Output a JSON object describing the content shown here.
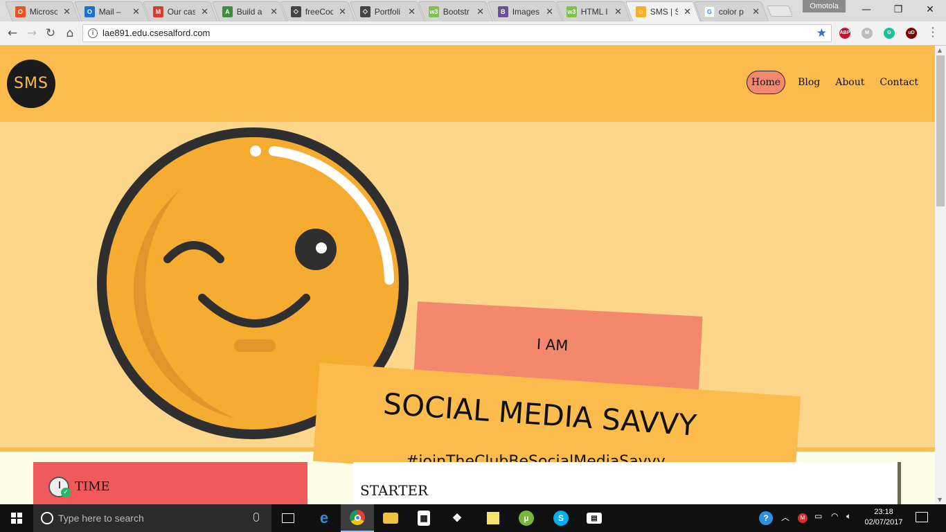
{
  "browser": {
    "tabs": [
      {
        "title": "Microsof",
        "icon": "office-icon",
        "color": "#e8541f",
        "glyph": "O"
      },
      {
        "title": "Mail – ",
        "icon": "outlook-icon",
        "color": "#1d6fcc",
        "glyph": "O"
      },
      {
        "title": "Our cas",
        "icon": "gmail-icon",
        "color": "#d93b2f",
        "glyph": "M"
      },
      {
        "title": "Build a",
        "icon": "build-icon",
        "color": "#3a8f3a",
        "glyph": "A"
      },
      {
        "title": "freeCod",
        "icon": "codepen-icon",
        "color": "#444444",
        "glyph": "◇"
      },
      {
        "title": "Portfoli",
        "icon": "codepen-icon",
        "color": "#444444",
        "glyph": "◇"
      },
      {
        "title": "Bootstr",
        "icon": "w3-icon",
        "color": "#7cc24c",
        "glyph": "w3"
      },
      {
        "title": "Images",
        "icon": "bootstrap-icon",
        "color": "#6b4f97",
        "glyph": "B"
      },
      {
        "title": "HTML I",
        "icon": "w3-icon",
        "color": "#7cc24c",
        "glyph": "w3"
      },
      {
        "title": "SMS | S",
        "icon": "smiley-icon",
        "color": "#f5b02e",
        "glyph": "☺"
      },
      {
        "title": "color p",
        "icon": "google-icon",
        "color": "#ffffff",
        "glyph": "G"
      }
    ],
    "profile_name": "Omotola",
    "url": "lae891.edu.csesalford.com",
    "extensions": [
      {
        "name": "adblock-icon",
        "glyph": "ABP",
        "color": "#c8102e"
      },
      {
        "name": "mail-ext-icon",
        "glyph": "M",
        "color": "#bdbdbd"
      },
      {
        "name": "grammarly-icon",
        "glyph": "G",
        "color": "#15c39a"
      },
      {
        "name": "ublock-icon",
        "glyph": "uD",
        "color": "#800000"
      }
    ]
  },
  "site": {
    "logo": "SMS",
    "nav": [
      "Home",
      "Blog",
      "About",
      "Contact"
    ],
    "hero": {
      "iam": "I AM",
      "title": "SOCIAL MEDIA SAVVY",
      "hashtag": "#joinTheClubBeSocialMediaSavvy"
    },
    "cards": {
      "time_label": "TIME",
      "starter_label": "STARTER"
    }
  },
  "taskbar": {
    "search_placeholder": "Type here to search",
    "time": "23:18",
    "date": "02/07/2017",
    "apps": [
      "edge-icon",
      "chrome-icon",
      "file-explorer-icon",
      "store-icon",
      "dropbox-icon",
      "sticky-notes-icon",
      "utorrent-icon",
      "skype-icon",
      "video-editor-icon"
    ]
  },
  "colors": {
    "header": "#fcbc4d",
    "hero": "#fcd68a",
    "accent_salmon": "#f3886d",
    "card_red": "#f15a5c"
  }
}
